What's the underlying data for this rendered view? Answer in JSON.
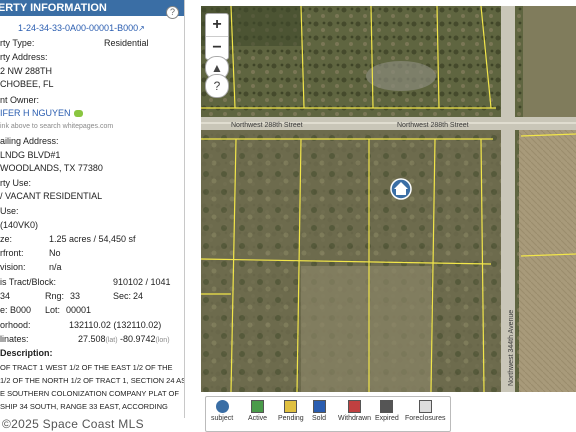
{
  "panel": {
    "title": "OPERTY INFORMATION",
    "help_label": "?",
    "parcel_id": "1-24-34-33-0A00-00001-B000",
    "property_type_label": "rty Type:",
    "property_type_value": "Residential",
    "property_address_label": "rty Address:",
    "address_line1": "2 NW 288TH",
    "address_line2": "CHOBEE, FL",
    "owner_label": "nt Owner:",
    "owner_name": "IFER H NGUYEN",
    "owner_hint": "ink above to search whitepages.com",
    "mailing_label": "ailing Address:",
    "mailing_line1": "LNDG BLVD#1",
    "mailing_line2": "WOODLANDS, TX 77380",
    "use_label": "rty Use:",
    "use_value": "/ VACANT RESIDENTIAL",
    "zoning_label": "Use:",
    "zoning_value": "(140VK0)",
    "size_label": "ze:",
    "size_value": "1.25 acres / 54,450 sf",
    "waterfront_label": "rfront:",
    "waterfront_value": "No",
    "subdivision_label": "vision:",
    "subdivision_value": "n/a",
    "census_label": "is Tract/Block:",
    "census_value": "910102 / 1041",
    "twp_value": "34",
    "rng_label": "Rng:",
    "rng_value": "33",
    "sec_label": "Sec:",
    "sec_value": "24",
    "blk_value": "e: B000",
    "lot_label": "Lot:",
    "lot_value": "00001",
    "nbhd_label": "orhood:",
    "nbhd_value": "132110.02 (132110.02)",
    "coord_label": "linates:",
    "lat_value": "27.508",
    "lat_unit": "(lat)",
    "lon_value": "-80.9742",
    "lon_unit": "(lon)",
    "desc_label": "Description:",
    "desc_line1": "OF TRACT 1 WEST 1/2 OF THE EAST 1/2 OF THE",
    "desc_line2": "1/2 OF THE NORTH 1/2 OF TRACT 1, SECTION 24 AS",
    "desc_line3": "E SOUTHERN COLONIZATION COMPANY PLAT OF",
    "desc_line4": "SHIP 34 SOUTH, RANGE 33 EAST, ACCORDING"
  },
  "map": {
    "street_top_left": "Northwest 288th Street",
    "street_top_right": "Northwest 288th Street",
    "street_right": "Northwest 344th Avenue",
    "zoom_in": "+",
    "zoom_out": "−",
    "compass": "▲",
    "help": "?"
  },
  "legend": {
    "subject": "subject",
    "active": "Active",
    "pending": "Pending",
    "sold": "Sold",
    "withdrawn": "Withdrawn",
    "expired": "Expired",
    "foreclosures": "Foreclosures"
  },
  "watermark": "©2025 Space Coast MLS",
  "colors": {
    "title_bar": "#3a6ea5",
    "parcel_line": "#f2e64a",
    "link": "#2a5db0"
  }
}
